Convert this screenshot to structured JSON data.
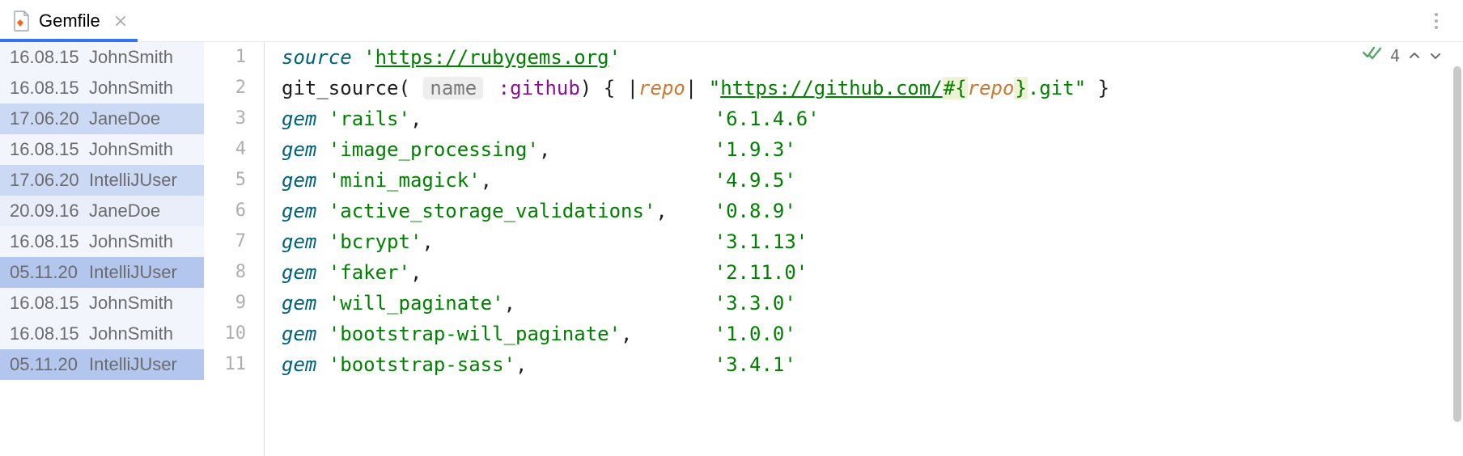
{
  "tab": {
    "filename": "Gemfile"
  },
  "inspections": {
    "count": "4"
  },
  "lines": [
    {
      "blame": {
        "date": "16.08.15",
        "author": "JohnSmith",
        "shade": "#f2f5fc"
      },
      "tokens": [
        {
          "t": "kw",
          "v": "source"
        },
        {
          "t": "txt",
          "v": " "
        },
        {
          "t": "str",
          "v": "'"
        },
        {
          "t": "str-u",
          "v": "https://rubygems.org"
        },
        {
          "t": "str",
          "v": "'"
        }
      ]
    },
    {
      "blame": {
        "date": "16.08.15",
        "author": "JohnSmith",
        "shade": "#f2f5fc"
      },
      "tokens": [
        {
          "t": "txt",
          "v": "git_source( "
        },
        {
          "t": "hint",
          "v": "name"
        },
        {
          "t": "txt",
          "v": " "
        },
        {
          "t": "sym",
          "v": ":github"
        },
        {
          "t": "txt",
          "v": ") { |"
        },
        {
          "t": "param",
          "v": "repo"
        },
        {
          "t": "txt",
          "v": "| "
        },
        {
          "t": "str",
          "v": "\""
        },
        {
          "t": "str-u",
          "v": "https://github.com/"
        },
        {
          "t": "interp-open",
          "v": "#{"
        },
        {
          "t": "param",
          "v": "repo"
        },
        {
          "t": "interp-close",
          "v": "}"
        },
        {
          "t": "str",
          "v": ".git\""
        },
        {
          "t": "txt",
          "v": " }"
        }
      ]
    },
    {
      "blame": {
        "date": "17.06.20",
        "author": "JaneDoe",
        "shade": "#ccd9f4"
      },
      "gem": {
        "name": "rails",
        "version": "6.1.4.6"
      }
    },
    {
      "blame": {
        "date": "16.08.15",
        "author": "JohnSmith",
        "shade": "#f2f5fc"
      },
      "gem": {
        "name": "image_processing",
        "version": "1.9.3"
      }
    },
    {
      "blame": {
        "date": "17.06.20",
        "author": "IntelliJUser",
        "shade": "#ccd9f4"
      },
      "gem": {
        "name": "mini_magick",
        "version": "4.9.5"
      }
    },
    {
      "blame": {
        "date": "20.09.16",
        "author": "JaneDoe",
        "shade": "#e9eefa"
      },
      "gem": {
        "name": "active_storage_validations",
        "version": "0.8.9"
      }
    },
    {
      "blame": {
        "date": "16.08.15",
        "author": "JohnSmith",
        "shade": "#f2f5fc"
      },
      "gem": {
        "name": "bcrypt",
        "version": "3.1.13"
      }
    },
    {
      "blame": {
        "date": "05.11.20",
        "author": "IntelliJUser",
        "shade": "#b3c6ee"
      },
      "gem": {
        "name": "faker",
        "version": "2.11.0"
      }
    },
    {
      "blame": {
        "date": "16.08.15",
        "author": "JohnSmith",
        "shade": "#f2f5fc"
      },
      "gem": {
        "name": "will_paginate",
        "version": "3.3.0"
      }
    },
    {
      "blame": {
        "date": "16.08.15",
        "author": "JohnSmith",
        "shade": "#f2f5fc"
      },
      "gem": {
        "name": "bootstrap-will_paginate",
        "version": "1.0.0"
      }
    },
    {
      "blame": {
        "date": "05.11.20",
        "author": "IntelliJUser",
        "shade": "#b3c6ee"
      },
      "gem": {
        "name": "bootstrap-sass",
        "version": "3.4.1"
      }
    }
  ]
}
